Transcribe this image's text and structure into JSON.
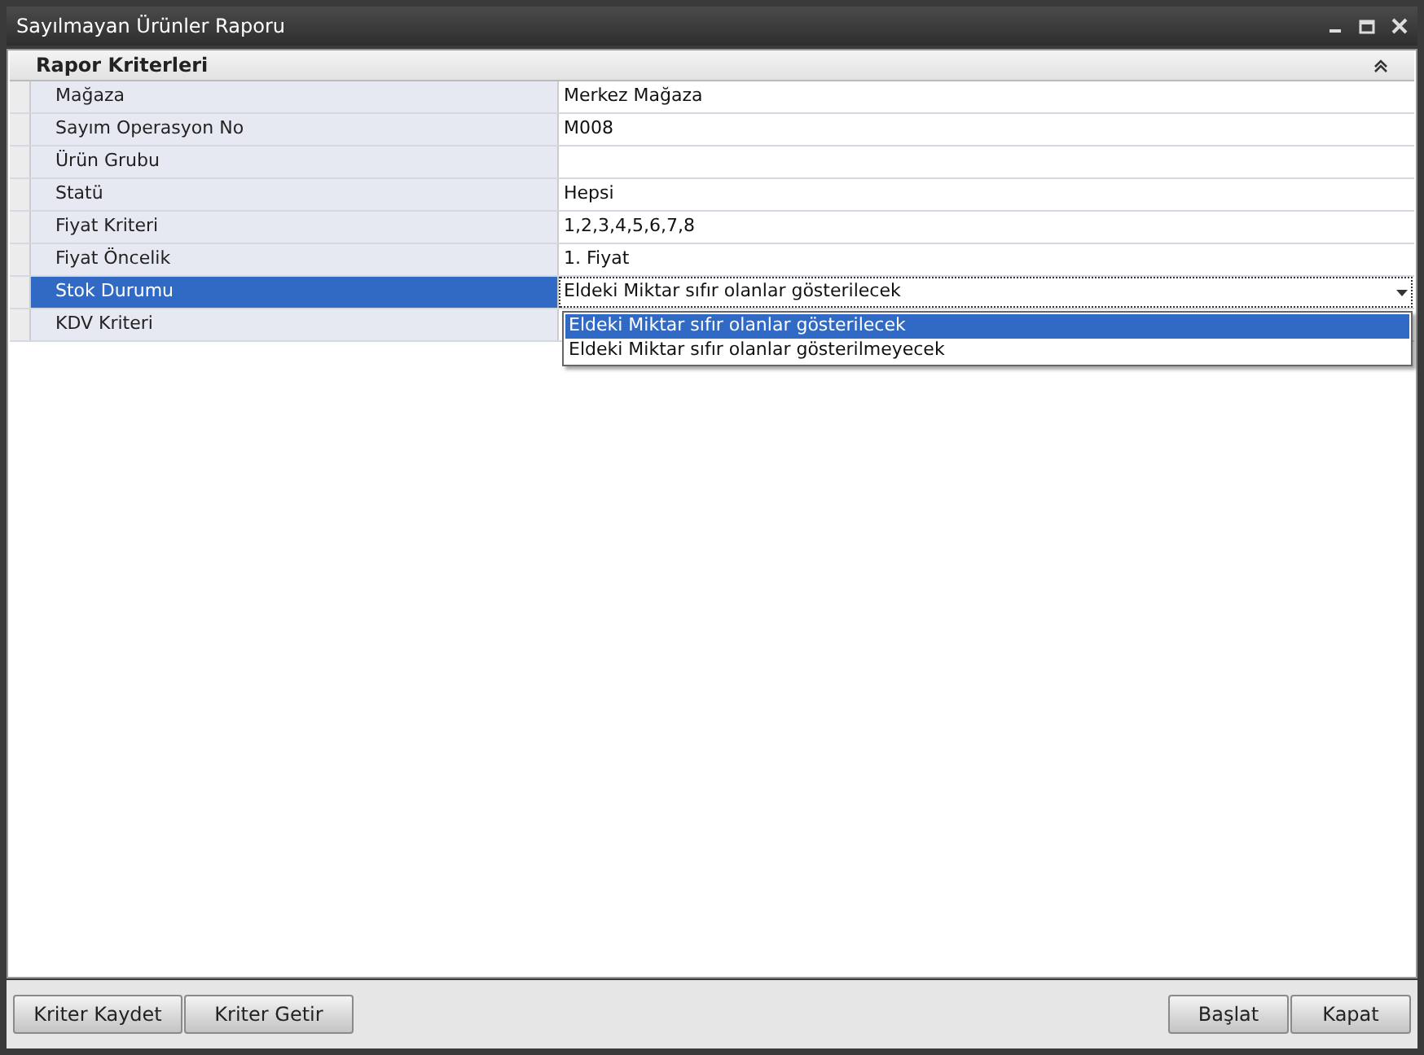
{
  "window": {
    "title": "Sayılmayan Ürünler Raporu"
  },
  "panel": {
    "title": "Rapor Kriterleri",
    "expanded": true
  },
  "rows": [
    {
      "label": "Mağaza",
      "value": "Merkez Mağaza",
      "selected": false
    },
    {
      "label": "Sayım Operasyon No",
      "value": "M008",
      "selected": false
    },
    {
      "label": "Ürün Grubu",
      "selected": false
    },
    {
      "label": "Statü",
      "value": "Hepsi",
      "selected": false
    },
    {
      "label": "Fiyat Kriteri",
      "value": "1,2,3,4,5,6,7,8",
      "selected": false
    },
    {
      "label": "Fiyat Öncelik",
      "value": "1. Fiyat",
      "selected": false
    },
    {
      "label": "Stok Durumu",
      "value": "Eldeki Miktar sıfır olanlar gösterilecek",
      "selected": true
    },
    {
      "label": "KDV Kriteri",
      "selected": false
    }
  ],
  "dropdown": {
    "options": [
      {
        "label": "Eldeki Miktar sıfır olanlar gösterilecek",
        "selected": true
      },
      {
        "label": "Eldeki Miktar sıfır olanlar gösterilmeyecek",
        "selected": false
      }
    ]
  },
  "buttons_left": [
    "Kriter Kaydet",
    "Kriter Getir"
  ],
  "buttons_right": [
    "Başlat",
    "Kapat"
  ]
}
